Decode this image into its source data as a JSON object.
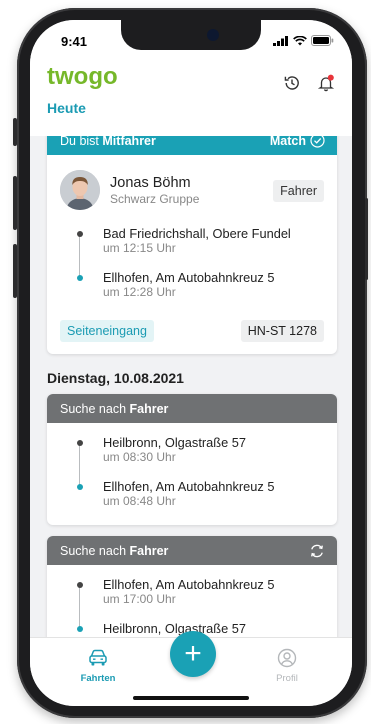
{
  "status_bar": {
    "time": "9:41"
  },
  "header": {
    "logo": "twogo",
    "section_title": "Heute"
  },
  "today_card": {
    "head_prefix": "Du bist",
    "role": "Mitfahrer",
    "match_label": "Match",
    "person": {
      "name": "Jonas Böhm",
      "company": "Schwarz Gruppe",
      "badge": "Fahrer"
    },
    "stops": [
      {
        "place": "Bad Friedrichshall, Obere Fundel",
        "time": "um 12:15 Uhr"
      },
      {
        "place": "Ellhofen, Am Autobahnkreuz 5",
        "time": "um 12:28 Uhr"
      }
    ],
    "tag": "Seiteneingang",
    "plate": "HN-ST 1278"
  },
  "date_heading": "Dienstag, 10.08.2021",
  "search_cards": [
    {
      "head_prefix": "Suche nach",
      "head_role": "Fahrer",
      "stops": [
        {
          "place": "Heilbronn, Olgastraße 57",
          "time": "um 08:30 Uhr"
        },
        {
          "place": "Ellhofen, Am Autobahnkreuz 5",
          "time": "um 08:48 Uhr"
        }
      ]
    },
    {
      "head_prefix": "Suche nach",
      "head_role": "Fahrer",
      "stops": [
        {
          "place": "Ellhofen, Am Autobahnkreuz 5",
          "time": "um 17:00 Uhr"
        },
        {
          "place": "Heilbronn, Olgastraße 57",
          "time": ""
        }
      ]
    }
  ],
  "bottom_nav": {
    "trips_label": "Fahrten",
    "profile_label": "Profil",
    "add_symbol": "+"
  },
  "colors": {
    "brand_green": "#76b82a",
    "teal": "#1aa1b5",
    "grey_header": "#6f7173"
  }
}
